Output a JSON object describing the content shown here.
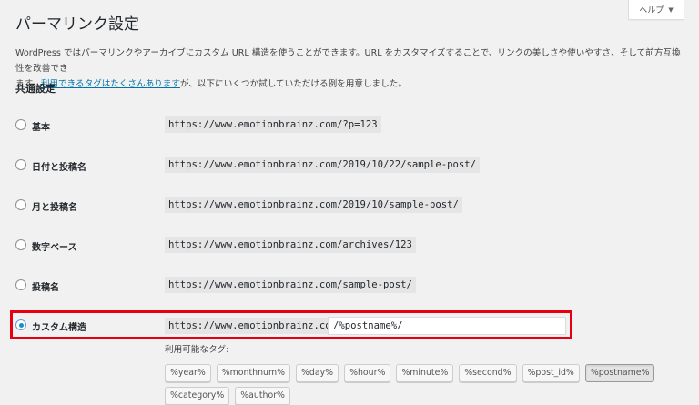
{
  "help_tab": {
    "label": "ヘルプ",
    "caret": "▼"
  },
  "page_title": "パーマリンク設定",
  "intro": {
    "line1": "WordPress ではパーマリンクやアーカイブにカスタム URL 構造を使うことができます。URL をカスタマイズすることで、リンクの美しさや使いやすさ、そして前方互換性を改善でき",
    "line2_start": "ます。",
    "link": "利用できるタグはたくさんあります",
    "line2_end": "が、以下にいくつか試していただける例を用意しました。"
  },
  "section_title": "共通設定",
  "options": [
    {
      "label": "基本",
      "url": "https://www.emotionbrainz.com/?p=123",
      "checked": false
    },
    {
      "label": "日付と投稿名",
      "url": "https://www.emotionbrainz.com/2019/10/22/sample-post/",
      "checked": false
    },
    {
      "label": "月と投稿名",
      "url": "https://www.emotionbrainz.com/2019/10/sample-post/",
      "checked": false
    },
    {
      "label": "数字ベース",
      "url": "https://www.emotionbrainz.com/archives/123",
      "checked": false
    },
    {
      "label": "投稿名",
      "url": "https://www.emotionbrainz.com/sample-post/",
      "checked": false
    }
  ],
  "custom": {
    "label": "カスタム構造",
    "base_url": "https://www.emotionbrainz.com",
    "value": "/%postname%/",
    "checked": true,
    "highlight_color": "#e60012"
  },
  "available_tags_label": "利用可能なタグ:",
  "tags_row1": [
    "%year%",
    "%monthnum%",
    "%day%",
    "%hour%",
    "%minute%",
    "%second%",
    "%post_id%",
    "%postname%"
  ],
  "tags_row2": [
    "%category%",
    "%author%"
  ],
  "active_tag": "%postname%"
}
